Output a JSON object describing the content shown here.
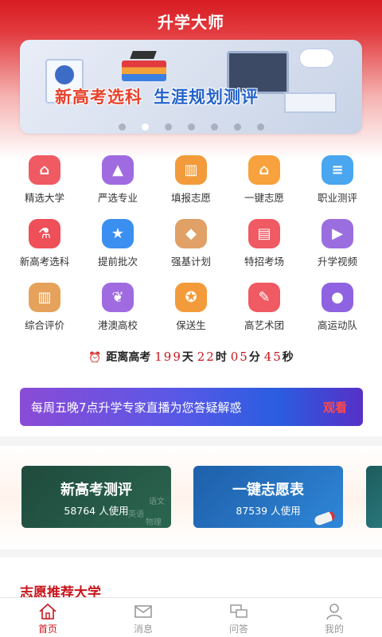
{
  "app": {
    "title": "升学大师"
  },
  "banner": {
    "text_red": "新高考选科",
    "text_blue": "生涯规划测评",
    "dot_count": 7,
    "active_dot": 1
  },
  "grid": [
    {
      "label": "精选大学",
      "icon": "university-icon",
      "color": "#ef5a63"
    },
    {
      "label": "严选专业",
      "icon": "compass-icon",
      "color": "#a06be0"
    },
    {
      "label": "填报志愿",
      "icon": "form-icon",
      "color": "#f39b3a"
    },
    {
      "label": "一键志愿",
      "icon": "home-flag-icon",
      "color": "#f7a23c"
    },
    {
      "label": "职业测评",
      "icon": "document-icon",
      "color": "#4aa6ef"
    },
    {
      "label": "新高考选科",
      "icon": "flask-icon",
      "color": "#ef4f58"
    },
    {
      "label": "提前批次",
      "icon": "star-icon",
      "color": "#3b8ff0"
    },
    {
      "label": "强基计划",
      "icon": "graduation-cap-icon",
      "color": "#e0a066"
    },
    {
      "label": "特招考场",
      "icon": "chat-card-icon",
      "color": "#ef5a63"
    },
    {
      "label": "升学视频",
      "icon": "video-icon",
      "color": "#9b6ee0"
    },
    {
      "label": "综合评价",
      "icon": "books-icon",
      "color": "#e6a25a"
    },
    {
      "label": "港澳高校",
      "icon": "leaf-icon",
      "color": "#a06be0"
    },
    {
      "label": "保送生",
      "icon": "medal-icon",
      "color": "#f39b3a"
    },
    {
      "label": "高艺术团",
      "icon": "palette-icon",
      "color": "#ef5a63"
    },
    {
      "label": "高运动队",
      "icon": "ball-icon",
      "color": "#8e62e0"
    }
  ],
  "countdown": {
    "label": "距离高考",
    "days": "199",
    "days_unit": "天",
    "hours": "22",
    "hours_unit": "时",
    "minutes": "05",
    "minutes_unit": "分",
    "seconds": "45",
    "seconds_unit": "秒"
  },
  "live": {
    "text": "每周五晚7点升学专家直播为您答疑解惑",
    "button": "观看"
  },
  "cards": [
    {
      "title": "新高考测评",
      "sub": "58764 人使用"
    },
    {
      "title": "一键志愿表",
      "sub": "87539 人使用"
    }
  ],
  "section": {
    "title": "志愿推荐大学"
  },
  "tabbar": [
    {
      "label": "首页",
      "icon": "home-icon",
      "active": true
    },
    {
      "label": "消息",
      "icon": "mail-icon",
      "active": false
    },
    {
      "label": "问答",
      "icon": "chat-icon",
      "active": false
    },
    {
      "label": "我的",
      "icon": "user-icon",
      "active": false
    }
  ],
  "colors": {
    "brand_red": "#c8161d",
    "tab_inactive": "#999999"
  }
}
